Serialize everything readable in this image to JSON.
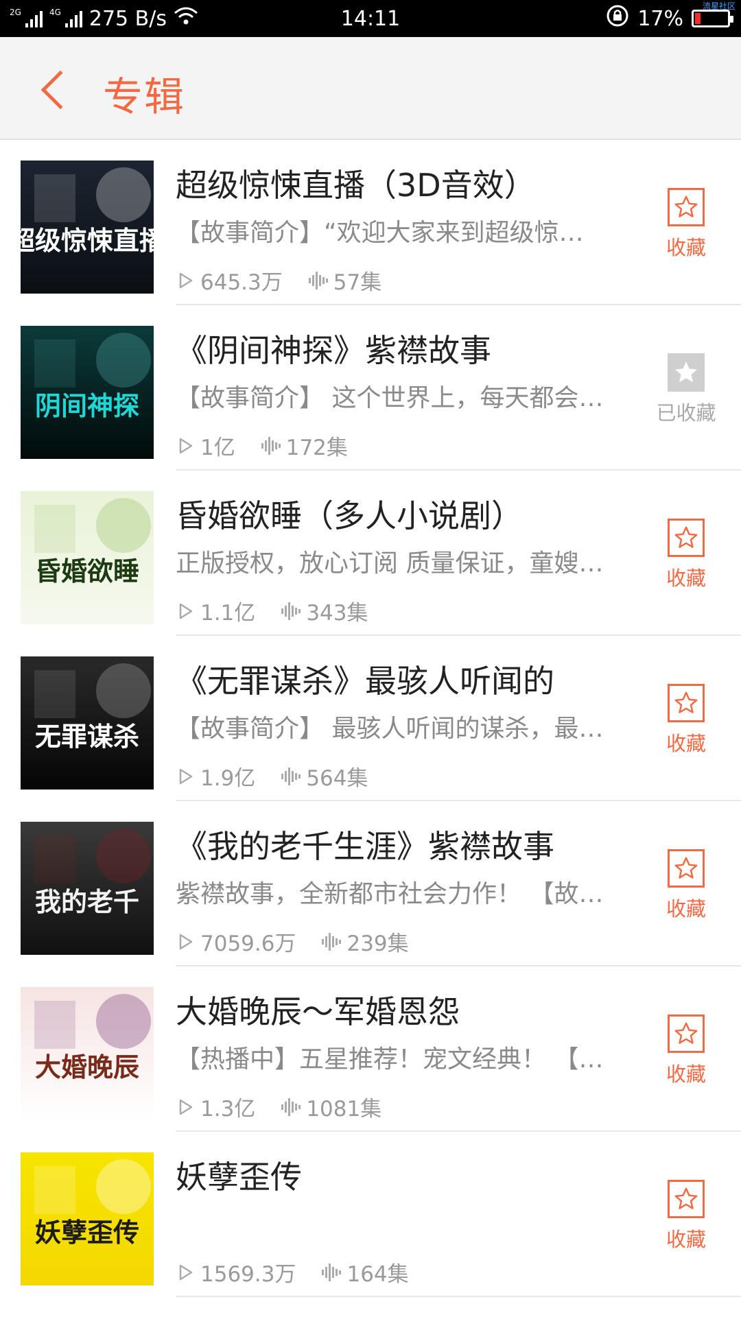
{
  "status_bar": {
    "net_2g": "2G",
    "net_4g": "4G",
    "speed": "275 B/s",
    "time": "14:11",
    "battery_percent": "17%",
    "battery_level": 0.17,
    "battery_color": "#ff2a2a",
    "corner_text": "流星社区"
  },
  "header": {
    "back_icon": "chevron-left-icon",
    "title": "专辑",
    "accent_color": "#f26a44"
  },
  "albums": [
    {
      "title": "超级惊悚直播（3D音效）",
      "desc": "【故事简介】“欢迎大家来到超级惊…",
      "plays": "645.3万",
      "episodes": "57集",
      "fav_label": "收藏",
      "favorited": false,
      "cover_text": "超级惊悚直播"
    },
    {
      "title": "《阴间神探》紫襟故事",
      "desc": "【故事简介】 这个世界上，每天都会…",
      "plays": "1亿",
      "episodes": "172集",
      "fav_label": "已收藏",
      "favorited": true,
      "cover_text": "阴间神探"
    },
    {
      "title": "昏婚欲睡（多人小说剧）",
      "desc": "正版授权，放心订阅 质量保证，童嫂…",
      "plays": "1.1亿",
      "episodes": "343集",
      "fav_label": "收藏",
      "favorited": false,
      "cover_text": "昏婚欲睡"
    },
    {
      "title": "《无罪谋杀》最骇人听闻的",
      "desc": "【故事简介】 最骇人听闻的谋杀，最…",
      "plays": "1.9亿",
      "episodes": "564集",
      "fav_label": "收藏",
      "favorited": false,
      "cover_text": "无罪谋杀"
    },
    {
      "title": "《我的老千生涯》紫襟故事",
      "desc": "紫襟故事，全新都市社会力作！ 【故…",
      "plays": "7059.6万",
      "episodes": "239集",
      "fav_label": "收藏",
      "favorited": false,
      "cover_text": "我的老千"
    },
    {
      "title": "大婚晚辰～军婚恩怨",
      "desc": "【热播中】五星推荐！宠文经典！ 【…",
      "plays": "1.3亿",
      "episodes": "1081集",
      "fav_label": "收藏",
      "favorited": false,
      "cover_text": "大婚晚辰"
    },
    {
      "title": "妖孽歪传",
      "desc": "",
      "plays": "1569.3万",
      "episodes": "164集",
      "fav_label": "收藏",
      "favorited": false,
      "cover_text": "妖孽歪传"
    }
  ]
}
